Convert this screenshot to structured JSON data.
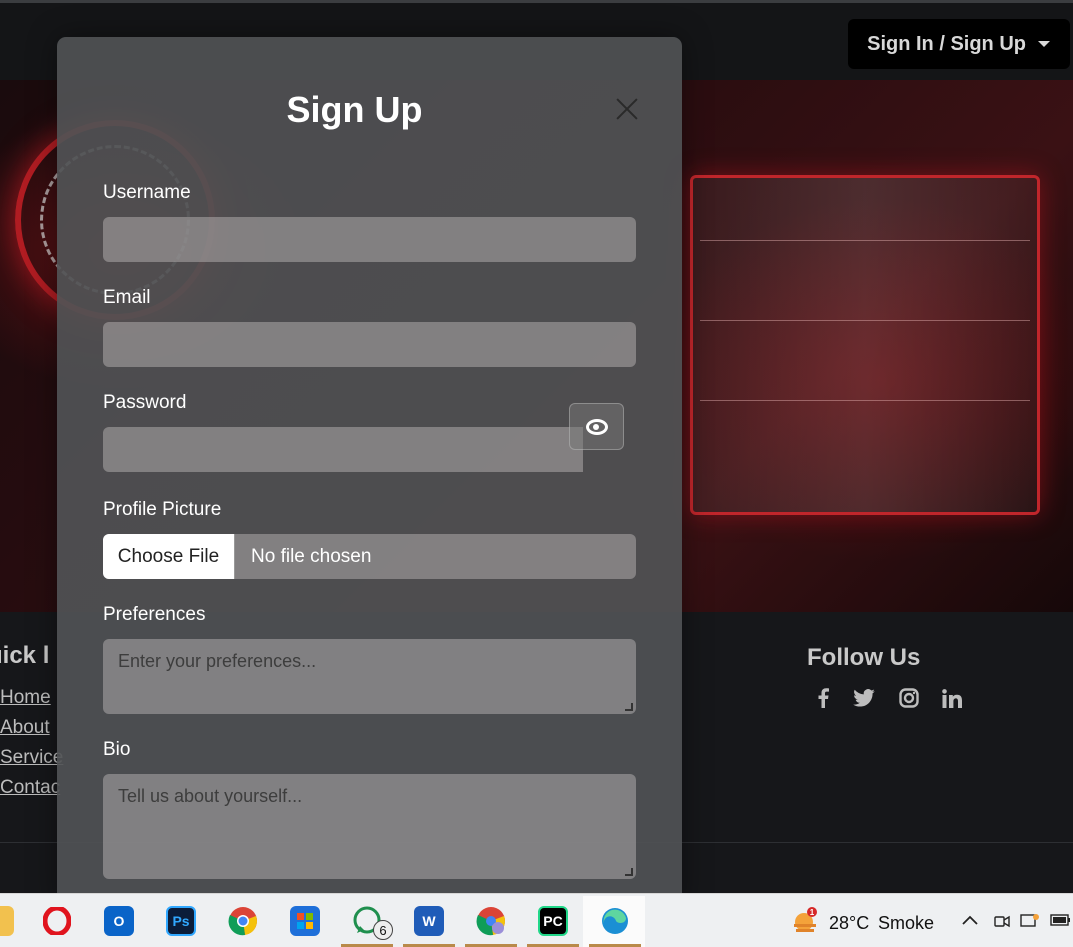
{
  "navbar": {
    "auth_dropdown_label": "Sign In / Sign Up"
  },
  "footer": {
    "quick_links_title": "uick l",
    "quick_links": [
      "Home",
      "About",
      "Service",
      "Contac"
    ],
    "follow_title": "Follow Us",
    "social_icons": [
      "facebook-icon",
      "twitter-icon",
      "instagram-icon",
      "linkedin-icon"
    ]
  },
  "modal": {
    "title": "Sign Up",
    "username_label": "Username",
    "email_label": "Email",
    "password_label": "Password",
    "profile_picture_label": "Profile Picture",
    "choose_file_label": "Choose File",
    "no_file_text": "No file chosen",
    "preferences_label": "Preferences",
    "preferences_placeholder": "Enter your preferences...",
    "bio_label": "Bio",
    "bio_placeholder": "Tell us about yourself..."
  },
  "taskbar": {
    "apps": [
      "file-explorer",
      "opera",
      "outlook",
      "photoshop",
      "chrome",
      "microsoft-store",
      "whatsapp",
      "word",
      "chrome-profile",
      "pycharm",
      "edge"
    ],
    "whatsapp_badge": "6",
    "weather_alert_badge": "1",
    "weather_temp": "28°C",
    "weather_desc": "Smoke"
  }
}
